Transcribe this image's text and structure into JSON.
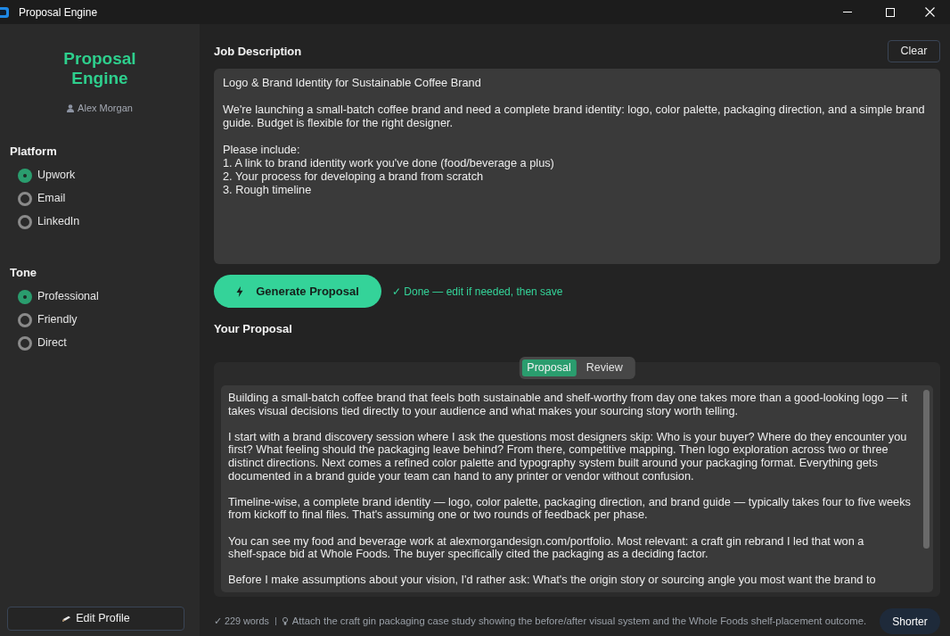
{
  "window": {
    "title": "Proposal Engine"
  },
  "sidebar": {
    "app_title": "Proposal Engine",
    "user": "Alex Morgan",
    "groups": [
      {
        "heading": "Platform",
        "options": [
          {
            "label": "Upwork",
            "selected": true
          },
          {
            "label": "Email",
            "selected": false
          },
          {
            "label": "LinkedIn",
            "selected": false
          }
        ]
      },
      {
        "heading": "Tone",
        "options": [
          {
            "label": "Professional",
            "selected": true
          },
          {
            "label": "Friendly",
            "selected": false
          },
          {
            "label": "Direct",
            "selected": false
          }
        ]
      }
    ],
    "edit_profile_button": "Edit Profile"
  },
  "job_description": {
    "heading": "Job Description",
    "clear_button": "Clear",
    "value": "Logo & Brand Identity for Sustainable Coffee Brand\n\nWe're launching a small-batch coffee brand and need a complete brand identity: logo, color palette, packaging direction, and a simple brand guide. Budget is flexible for the right designer.\n\nPlease include:\n1. A link to brand identity work you've done (food/beverage a plus)\n2. Your process for developing a brand from scratch\n3. Rough timeline"
  },
  "generate": {
    "button": "Generate Proposal",
    "status": "✓ Done — edit if needed, then save"
  },
  "proposal": {
    "heading": "Your Proposal",
    "tabs": [
      {
        "label": "Proposal",
        "selected": true
      },
      {
        "label": "Review",
        "selected": false
      }
    ],
    "value": "Building a small-batch coffee brand that feels both sustainable and shelf-worthy from day one takes more than a good-looking logo — it takes visual decisions tied directly to your audience and what makes your sourcing story worth telling.\n\nI start with a brand discovery session where I ask the questions most designers skip: Who is your buyer? Where do they encounter you first? What feeling should the packaging leave behind? From there, competitive mapping. Then logo exploration across two or three distinct directions. Next comes a refined color palette and typography system built around your packaging format. Everything gets documented in a brand guide your team can hand to any printer or vendor without confusion.\n\nTimeline-wise, a complete brand identity — logo, color palette, packaging direction, and brand guide — typically takes four to five weeks from kickoff to final files. That's assuming one or two rounds of feedback per phase.\n\nYou can see my food and beverage work at alexmorgandesign.com/portfolio. Most relevant: a craft gin rebrand I led that won a shelf-space bid at Whole Foods. The buyer specifically cited the packaging as a deciding factor.\n\nBefore I make assumptions about your vision, I'd rather ask: What's the origin story or sourcing angle you most want the brand to"
  },
  "footer": {
    "word_count": "✓ 229 words",
    "tip": "Attach the craft gin packaging case study showing the before/after visual system and the Whole Foods shelf-placement outcome.",
    "shorter_button": "Shorter"
  }
}
